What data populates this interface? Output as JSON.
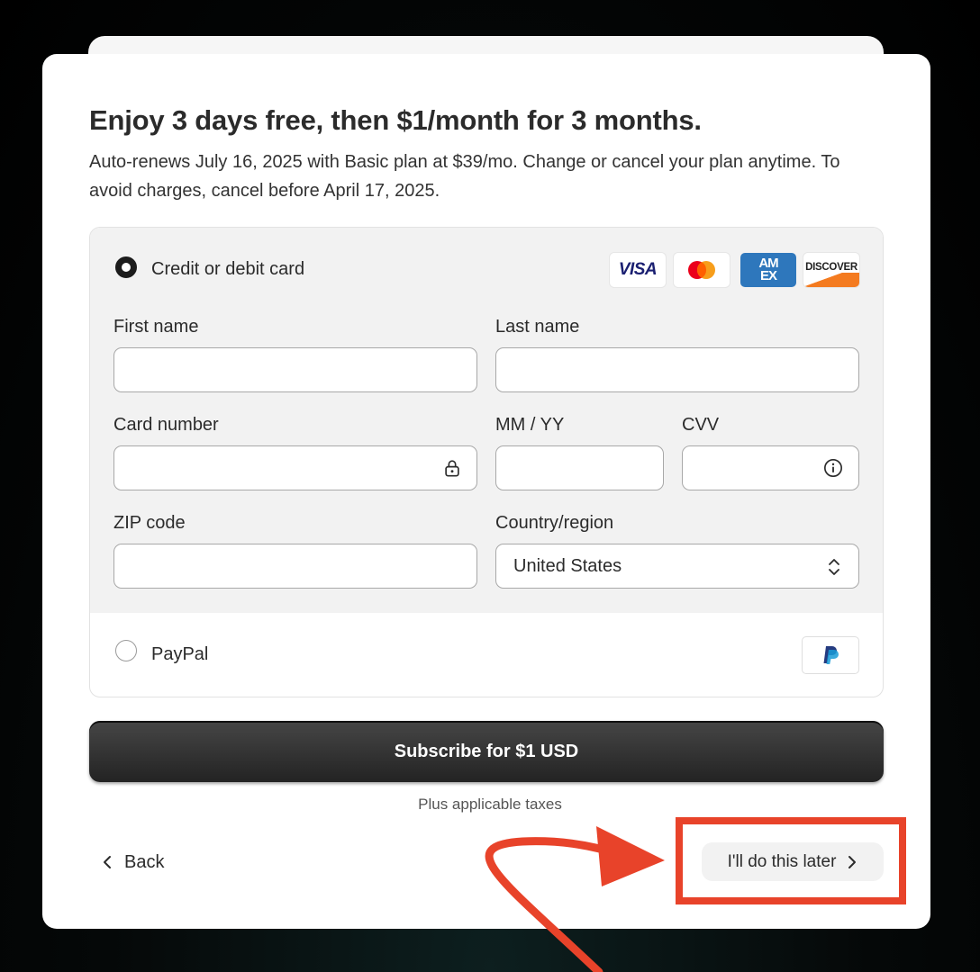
{
  "offer": {
    "title": "Enjoy 3 days free, then $1/month for 3 months.",
    "subtitle": "Auto-renews July 16, 2025 with Basic plan at $39/mo. Change or cancel your plan anytime. To avoid charges, cancel before April 17, 2025."
  },
  "payment": {
    "card_option": {
      "label": "Credit or debit card",
      "selected": true,
      "brands": [
        "VISA",
        "Mastercard",
        "AMEX",
        "DISCOVER"
      ],
      "brand_icons": [
        "visa-logo-icon",
        "mastercard-logo-icon",
        "amex-logo-icon",
        "discover-logo-icon"
      ]
    },
    "fields": {
      "first_name": {
        "label": "First name",
        "value": ""
      },
      "last_name": {
        "label": "Last name",
        "value": ""
      },
      "card_number": {
        "label": "Card number",
        "value": "",
        "icon": "lock-icon"
      },
      "expiry": {
        "label": "MM / YY",
        "value": ""
      },
      "cvv": {
        "label": "CVV",
        "value": "",
        "icon": "info-icon"
      },
      "zip": {
        "label": "ZIP code",
        "value": ""
      },
      "country": {
        "label": "Country/region",
        "value": "United States",
        "icon": "chevron-updown-icon"
      }
    },
    "paypal_option": {
      "label": "PayPal",
      "selected": false,
      "icon": "paypal-logo-icon"
    }
  },
  "actions": {
    "subscribe_label": "Subscribe for $1 USD",
    "taxes_note": "Plus applicable taxes",
    "back_label": "Back",
    "later_label": "I'll do this later"
  },
  "annotation": {
    "highlight_color": "#e8432a",
    "shapes": [
      "arrow",
      "highlight-box"
    ]
  },
  "colors": {
    "primary_button": "#2f2f2f",
    "card_section_bg": "#f2f2f2",
    "backdrop": "#050808"
  }
}
